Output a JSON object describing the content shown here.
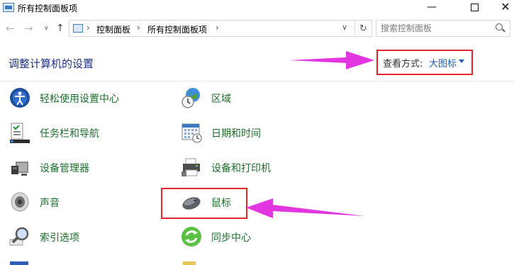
{
  "window": {
    "title": "所有控制面板项",
    "minimize": "—",
    "close": "✕"
  },
  "address": {
    "crumbs": [
      "控制面板",
      "所有控制面板项"
    ]
  },
  "search": {
    "placeholder": "搜索控制面板"
  },
  "heading": "调整计算机的设置",
  "view_by": {
    "label": "查看方式:",
    "value": "大图标"
  },
  "items": [
    {
      "label": "轻松使用设置中心",
      "icon": "ease-of-access-icon"
    },
    {
      "label": "区域",
      "icon": "region-globe-icon"
    },
    {
      "label": "任务栏和导航",
      "icon": "taskbar-icon"
    },
    {
      "label": "日期和时间",
      "icon": "calendar-clock-icon"
    },
    {
      "label": "设备管理器",
      "icon": "device-manager-icon"
    },
    {
      "label": "设备和打印机",
      "icon": "printer-icon"
    },
    {
      "label": "声音",
      "icon": "speaker-icon"
    },
    {
      "label": "鼠标",
      "icon": "mouse-icon"
    },
    {
      "label": "索引选项",
      "icon": "indexing-search-icon"
    },
    {
      "label": "同步中心",
      "icon": "sync-center-icon"
    }
  ],
  "colors": {
    "link_green": "#1d6f2c",
    "heading_blue": "#1e3287",
    "annotation_red": "#e3262b",
    "annotation_arrow": "#e236e0"
  }
}
